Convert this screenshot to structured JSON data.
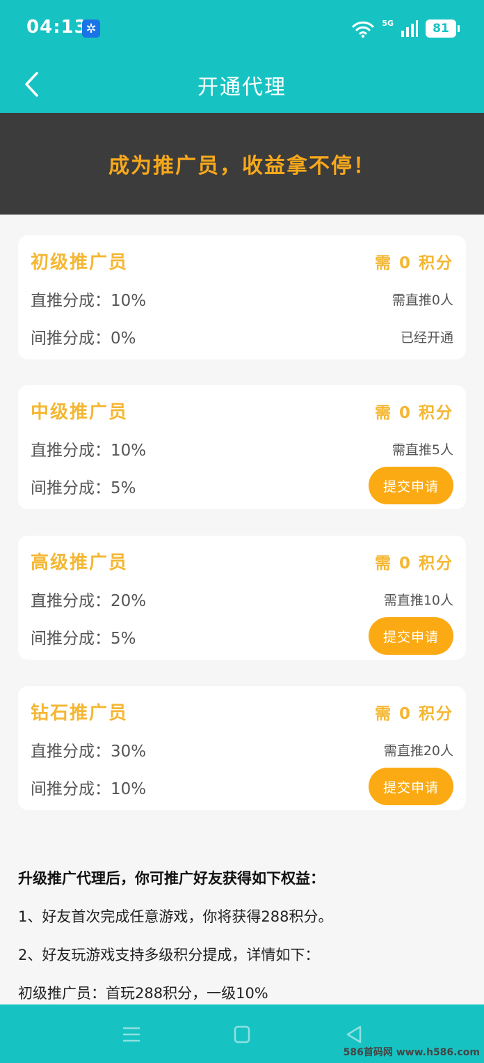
{
  "status_bar": {
    "time": "04:13",
    "battery": "81",
    "network": "5G"
  },
  "header": {
    "title": "开通代理"
  },
  "banner": {
    "text": "成为推广员，收益拿不停！"
  },
  "cards": [
    {
      "title": "初级推广员",
      "points": "需 0 积分",
      "direct": "直推分成：10%",
      "requirement": "需直推0人",
      "indirect": "间推分成：0%",
      "status": "已经开通"
    },
    {
      "title": "中级推广员",
      "points": "需 0 积分",
      "direct": "直推分成：10%",
      "requirement": "需直推5人",
      "indirect": "间推分成：5%",
      "button": "提交申请"
    },
    {
      "title": "高级推广员",
      "points": "需 0 积分",
      "direct": "直推分成：20%",
      "requirement": "需直推10人",
      "indirect": "间推分成：5%",
      "button": "提交申请"
    },
    {
      "title": "钻石推广员",
      "points": "需 0 积分",
      "direct": "直推分成：30%",
      "requirement": "需直推20人",
      "indirect": "间推分成：10%",
      "button": "提交申请"
    }
  ],
  "info": {
    "title": "升级推广代理后，你可推广好友获得如下权益：",
    "lines": [
      "1、好友首次完成任意游戏，你将获得288积分。",
      "2、好友玩游戏支持多级积分提成，详情如下：",
      "初级推广员：首玩288积分，一级10%"
    ]
  },
  "watermark": "586首码网 www.h586.com",
  "colors": {
    "teal": "#17c3c2",
    "gold": "#f4b733",
    "button": "#fbaa13",
    "banner_bg": "#3c3c3c"
  }
}
